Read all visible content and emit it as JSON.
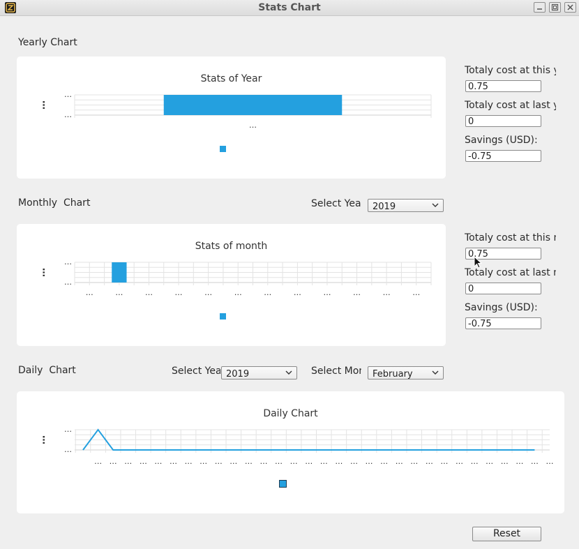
{
  "window": {
    "title": "Stats Chart"
  },
  "colors": {
    "bar": "#24a0df",
    "grid": "#e3e3e3",
    "axis": "#cfcfcf",
    "panel": "#ffffff",
    "background": "#efefef"
  },
  "yearly": {
    "section_label": "Yearly Chart",
    "chart_title": "Stats of Year",
    "y_axis_label": "…",
    "y_ticks": [
      "…",
      "…"
    ],
    "x_ticks": [
      "…"
    ],
    "side": {
      "this_label": "Totaly cost at this year:",
      "this_value": "0.75",
      "last_label": "Totaly cost at last year:",
      "last_value": "0",
      "savings_label": "Savings (USD):",
      "savings_value": "-0.75"
    }
  },
  "monthly": {
    "section_label": "Monthly  Chart",
    "select_year_label": "Select Year",
    "year_value": "2019",
    "chart_title": "Stats of month",
    "y_axis_label": "…",
    "y_ticks": [
      "…",
      "…"
    ],
    "x_ticks": [
      "…",
      "…",
      "…",
      "…",
      "…",
      "…",
      "…",
      "…",
      "…",
      "…",
      "…",
      "…"
    ],
    "side": {
      "this_label": "Totaly cost at this month:",
      "this_value": "0.75",
      "last_label": "Totaly cost at last month:",
      "last_value": "0",
      "savings_label": "Savings (USD):",
      "savings_value": "-0.75"
    }
  },
  "daily": {
    "section_label": "Daily  Chart",
    "select_year_label": "Select Year",
    "year_value": "2019",
    "select_month_label": "Select Month",
    "month_value": "February",
    "chart_title": "Daily Chart",
    "y_axis_label": "…",
    "y_ticks": [
      "…",
      "…"
    ],
    "x_tick_label": "…"
  },
  "reset_label": "Reset",
  "chart_data": [
    {
      "type": "bar",
      "title": "Stats of Year",
      "categories": [
        "…"
      ],
      "values": [
        0.75
      ],
      "ylim": [
        0,
        0.75
      ]
    },
    {
      "type": "bar",
      "title": "Stats of month",
      "categories": [
        "…",
        "…",
        "…",
        "…",
        "…",
        "…",
        "…",
        "…",
        "…",
        "…",
        "…",
        "…"
      ],
      "values": [
        0,
        0.75,
        0,
        0,
        0,
        0,
        0,
        0,
        0,
        0,
        0,
        0
      ],
      "ylim": [
        0,
        0.75
      ]
    },
    {
      "type": "line",
      "title": "Daily Chart",
      "points": 31,
      "values": [
        0,
        0.75,
        0,
        0,
        0,
        0,
        0,
        0,
        0,
        0,
        0,
        0,
        0,
        0,
        0,
        0,
        0,
        0,
        0,
        0,
        0,
        0,
        0,
        0,
        0,
        0,
        0,
        0,
        0,
        0,
        0
      ],
      "ylim": [
        0,
        0.75
      ]
    }
  ]
}
